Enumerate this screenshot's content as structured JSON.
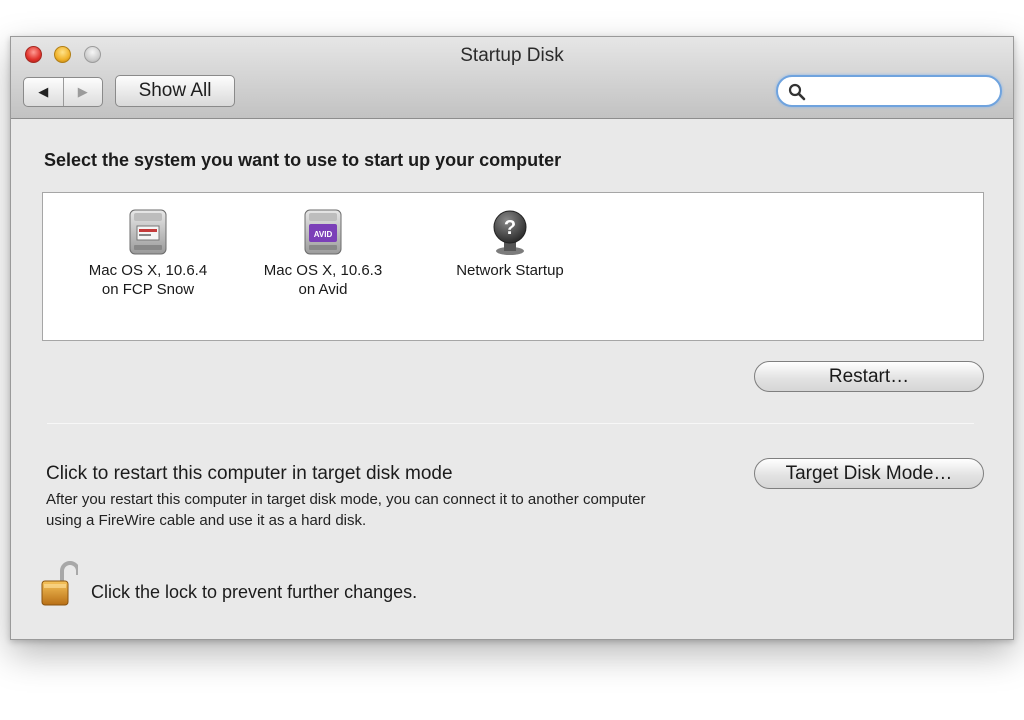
{
  "window": {
    "title": "Startup Disk"
  },
  "toolbar": {
    "back_glyph": "◀",
    "forward_glyph": "▶",
    "show_all_label": "Show All",
    "search_value": "",
    "search_placeholder": ""
  },
  "main": {
    "heading": "Select the system you want to use to start up your computer",
    "disks": [
      {
        "label": "Mac OS X, 10.6.4\non FCP Snow",
        "icon": "hard-drive-icon"
      },
      {
        "label": "Mac OS X, 10.6.3\non Avid",
        "icon": "avid-drive-icon",
        "badge": "AVID"
      },
      {
        "label": "Network Startup",
        "icon": "network-startup-icon",
        "badge": "?"
      }
    ],
    "restart_label": "Restart…",
    "target_mode": {
      "title": "Click to restart this computer in target disk mode",
      "description": "After you restart this computer in target disk mode, you can connect it to another computer using a FireWire cable and use it as a hard disk.",
      "button_label": "Target Disk Mode…"
    },
    "lock_text": "Click the lock to prevent further changes."
  },
  "colors": {
    "search_focus": "#6fa3de",
    "close": "#e0322b",
    "minimize": "#f0b22a",
    "avid_purple": "#7b3fb8",
    "lock_gold": "#d8902a"
  }
}
